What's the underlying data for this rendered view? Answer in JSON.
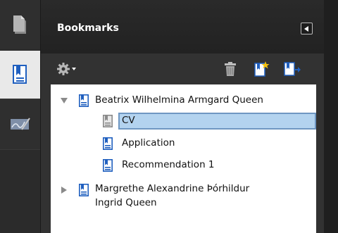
{
  "panel": {
    "title": "Bookmarks"
  },
  "icons": {
    "rail": [
      "pages-icon",
      "bookmarks-icon",
      "signature-icon"
    ],
    "toolbar": [
      "options-gear-icon",
      "delete-trash-icon",
      "new-bookmark-icon",
      "expand-bookmark-icon"
    ],
    "collapse": "collapse-panel-icon"
  },
  "colors": {
    "selection_fill": "#b3d3ef",
    "selection_border": "#6f97c2",
    "accent_blue": "#1f5fbf"
  },
  "bookmarks": [
    {
      "label": "Beatrix Wilhelmina Armgard Queen",
      "expanded": true,
      "level": 0
    },
    {
      "label": "CV",
      "selected": true,
      "level": 1
    },
    {
      "label": "Application",
      "level": 1
    },
    {
      "label": "Recommendation 1",
      "level": 1
    },
    {
      "label_line1": "Margrethe Alexandrine Þórhildur",
      "label_line2": "Ingrid Queen",
      "expanded": false,
      "level": 0
    }
  ]
}
